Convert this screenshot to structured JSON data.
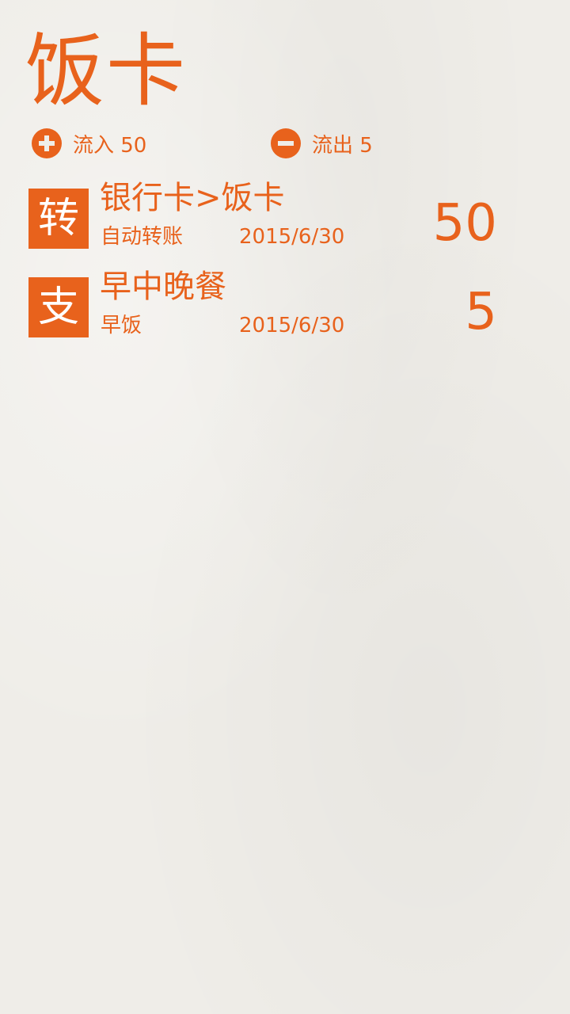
{
  "page": {
    "title": "饭卡"
  },
  "summary": {
    "inflow_label": "流入 50",
    "outflow_label": "流出 5"
  },
  "transactions": [
    {
      "badge": "转",
      "name": "银行卡>饭卡",
      "note": "自动转账",
      "date": "2015/6/30",
      "amount": "50"
    },
    {
      "badge": "支",
      "name": "早中晚餐",
      "note": "早饭",
      "date": "2015/6/30",
      "amount": "5"
    }
  ],
  "colors": {
    "accent": "#e8621c",
    "background": "#efede8"
  },
  "icons": {
    "inflow": "plus-circle-icon",
    "outflow": "minus-circle-icon"
  }
}
